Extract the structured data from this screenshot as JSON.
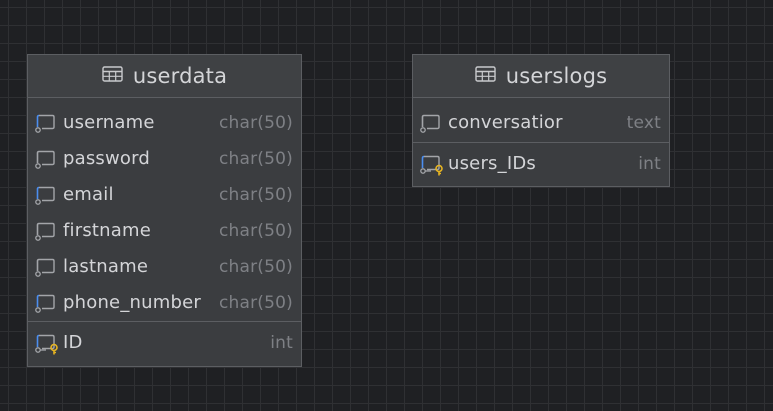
{
  "tables": {
    "userdata": {
      "name": "userdata",
      "columns": [
        {
          "name": "username",
          "type": "char(50)",
          "icon": "column-icon",
          "accent": "#4b8ef0"
        },
        {
          "name": "password",
          "type": "char(50)",
          "icon": "column-icon",
          "accent": "#a3a5a9"
        },
        {
          "name": "email",
          "type": "char(50)",
          "icon": "column-icon",
          "accent": "#4b8ef0"
        },
        {
          "name": "firstname",
          "type": "char(50)",
          "icon": "column-icon",
          "accent": "#a3a5a9"
        },
        {
          "name": "lastname",
          "type": "char(50)",
          "icon": "column-icon",
          "accent": "#a3a5a9"
        },
        {
          "name": "phone_number",
          "type": "char(50)",
          "icon": "column-icon",
          "accent": "#4b8ef0"
        }
      ],
      "key_column": {
        "name": "ID",
        "type": "int",
        "icon": "primary-key-column-icon",
        "accent": "#4b8ef0",
        "key_color": "#e6b422"
      }
    },
    "userslogs": {
      "name": "userslogs",
      "columns": [
        {
          "name": "conversatior",
          "type": "text",
          "icon": "column-icon",
          "accent": "#a3a5a9"
        }
      ],
      "key_column": {
        "name": "users_IDs",
        "type": "int",
        "icon": "key-column-icon",
        "accent": "#4b8ef0",
        "key_color": "#e6b422"
      }
    }
  }
}
